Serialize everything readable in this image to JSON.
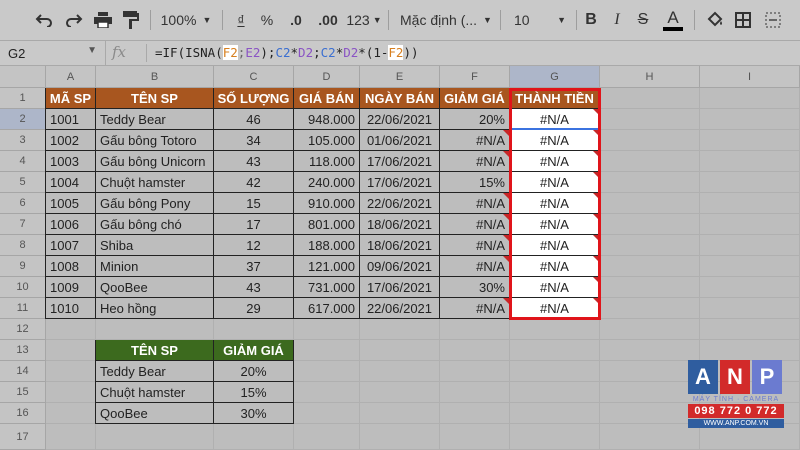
{
  "toolbar": {
    "zoom": "100%",
    "currency": "₫",
    "percent": "%",
    "dec_less": ".0",
    "dec_more": ".00",
    "more_formats": "123",
    "font": "Mặc định (...",
    "font_size": "10",
    "bold": "B",
    "italic": "I",
    "strike": "S",
    "text_color": "A"
  },
  "formula_bar": {
    "name_box": "G2",
    "fx": "fx",
    "formula_parts": [
      "=IF(ISNA(",
      "F2",
      ";",
      "E2",
      ");",
      "C2",
      "*",
      "D2",
      ";",
      "C2",
      "*",
      "D2",
      "*(1-",
      "F2",
      "))"
    ]
  },
  "columns": [
    "A",
    "B",
    "C",
    "D",
    "E",
    "F",
    "G",
    "H",
    "I"
  ],
  "rows": [
    "1",
    "2",
    "3",
    "4",
    "5",
    "6",
    "7",
    "8",
    "9",
    "10",
    "11",
    "12",
    "13",
    "14",
    "15",
    "16",
    "17"
  ],
  "main_table": {
    "headers": [
      "MÃ SP",
      "TÊN SP",
      "SỐ LƯỢNG",
      "GIÁ BÁN",
      "NGÀY BÁN",
      "GIẢM GIÁ",
      "THÀNH TIỀN"
    ],
    "rows": [
      [
        "1001",
        "Teddy Bear",
        "46",
        "948.000",
        "22/06/2021",
        "20%",
        "#N/A"
      ],
      [
        "1002",
        "Gấu bông Totoro",
        "34",
        "105.000",
        "01/06/2021",
        "#N/A",
        "#N/A"
      ],
      [
        "1003",
        "Gấu bông Unicorn",
        "43",
        "118.000",
        "17/06/2021",
        "#N/A",
        "#N/A"
      ],
      [
        "1004",
        "Chuột hamster",
        "42",
        "240.000",
        "17/06/2021",
        "15%",
        "#N/A"
      ],
      [
        "1005",
        "Gấu bông Pony",
        "15",
        "910.000",
        "22/06/2021",
        "#N/A",
        "#N/A"
      ],
      [
        "1006",
        "Gấu bông chó",
        "17",
        "801.000",
        "18/06/2021",
        "#N/A",
        "#N/A"
      ],
      [
        "1007",
        "Shiba",
        "12",
        "188.000",
        "18/06/2021",
        "#N/A",
        "#N/A"
      ],
      [
        "1008",
        "Minion",
        "37",
        "121.000",
        "09/06/2021",
        "#N/A",
        "#N/A"
      ],
      [
        "1009",
        "QooBee",
        "43",
        "731.000",
        "17/06/2021",
        "30%",
        "#N/A"
      ],
      [
        "1010",
        "Heo hồng",
        "29",
        "617.000",
        "22/06/2021",
        "#N/A",
        "#N/A"
      ]
    ]
  },
  "discount_table": {
    "headers": [
      "TÊN SP",
      "GIẢM GIÁ"
    ],
    "rows": [
      [
        "Teddy Bear",
        "20%"
      ],
      [
        "Chuột hamster",
        "15%"
      ],
      [
        "QooBee",
        "30%"
      ]
    ]
  },
  "logo": {
    "letters": [
      "A",
      "N",
      "P"
    ],
    "tagline": "MÁY TÍNH · CAMERA",
    "phone": "098 772 0 772",
    "website": "WWW.ANP.COM.VN"
  },
  "colors": {
    "header_brown": "#a8561f",
    "header_green": "#3c6a1e",
    "highlight_red": "#e0141a",
    "selection_blue": "#3b73e0"
  }
}
